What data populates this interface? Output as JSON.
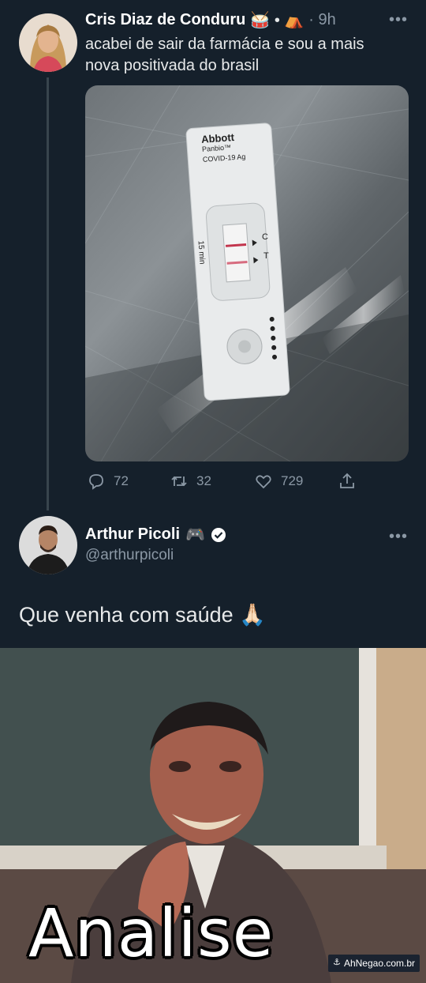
{
  "tweet1": {
    "author": "Cris Diaz de Conduru",
    "emoji": "🥁 • ⛺",
    "time": "· 9h",
    "more": "•••",
    "text_line1": "acabei de sair da farmácia e sou a mais",
    "text_line2": "nova positivada do brasil",
    "test_brand": "Abbott",
    "test_product_line1": "Panbio™",
    "test_product_line2": "COVID-19 Ag",
    "test_time": "15 min",
    "test_c": "C",
    "test_t": "T",
    "replies": "72",
    "retweets": "32",
    "likes": "729"
  },
  "tweet2": {
    "author": "Arthur Picoli",
    "emoji": "🎮",
    "handle": "@arthurpicoli",
    "more": "•••",
    "text": "Que venha com saúde 🙏🏻"
  },
  "meme": {
    "caption": "Analise",
    "watermark": "AhNegao.com.br"
  },
  "colors": {
    "background": "#15202b",
    "muted": "#8b98a5",
    "text": "#e7e9ea"
  }
}
